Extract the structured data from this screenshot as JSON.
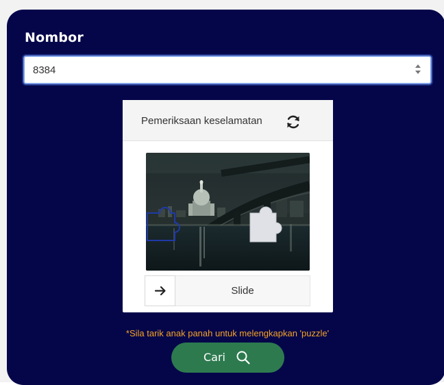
{
  "form": {
    "number_label": "Nombor",
    "number_value": "8384"
  },
  "captcha": {
    "title": "Pemeriksaan keselamatan",
    "slider_label": "Slide",
    "icons": {
      "refresh": "refresh-icon",
      "arrow": "arrow-right-icon"
    }
  },
  "hint": "*Sila tarik anak panah untuk melengkapkan 'puzzle'",
  "search_button": {
    "label": "Cari",
    "icon": "search-icon"
  },
  "colors": {
    "panel_background": "#05064a",
    "hint_text": "#f5a326",
    "button_background": "#2d7a4f"
  }
}
